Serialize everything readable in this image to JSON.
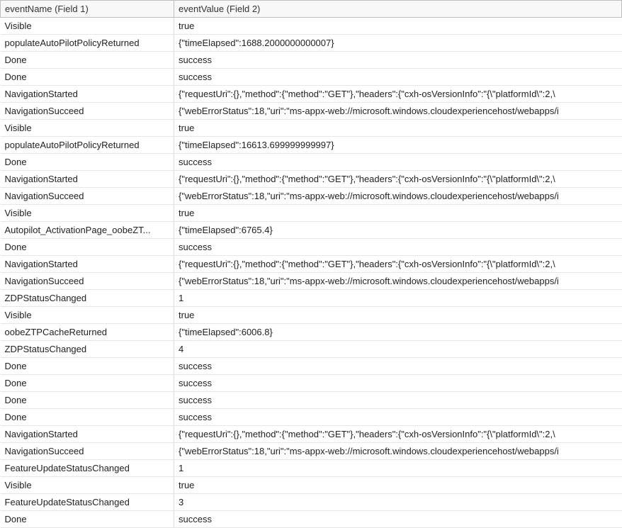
{
  "columns": {
    "col1": "eventName (Field 1)",
    "col2": "eventValue (Field 2)"
  },
  "rows": [
    {
      "name": "Visible",
      "value": "true"
    },
    {
      "name": "populateAutoPilotPolicyReturned",
      "value": "{\"timeElapsed\":1688.2000000000007}"
    },
    {
      "name": "Done",
      "value": "success"
    },
    {
      "name": "Done",
      "value": "success"
    },
    {
      "name": "NavigationStarted",
      "value": "{\"requestUri\":{},\"method\":{\"method\":\"GET\"},\"headers\":{\"cxh-osVersionInfo\":\"{\\\"platformId\\\":2,\\"
    },
    {
      "name": "NavigationSucceed",
      "value": "{\"webErrorStatus\":18,\"uri\":\"ms-appx-web://microsoft.windows.cloudexperiencehost/webapps/i"
    },
    {
      "name": "Visible",
      "value": "true"
    },
    {
      "name": "populateAutoPilotPolicyReturned",
      "value": "{\"timeElapsed\":16613.699999999997}"
    },
    {
      "name": "Done",
      "value": "success"
    },
    {
      "name": "NavigationStarted",
      "value": "{\"requestUri\":{},\"method\":{\"method\":\"GET\"},\"headers\":{\"cxh-osVersionInfo\":\"{\\\"platformId\\\":2,\\"
    },
    {
      "name": "NavigationSucceed",
      "value": "{\"webErrorStatus\":18,\"uri\":\"ms-appx-web://microsoft.windows.cloudexperiencehost/webapps/i"
    },
    {
      "name": "Visible",
      "value": "true"
    },
    {
      "name": "Autopilot_ActivationPage_oobeZT...",
      "value": "{\"timeElapsed\":6765.4}"
    },
    {
      "name": "Done",
      "value": "success"
    },
    {
      "name": "NavigationStarted",
      "value": "{\"requestUri\":{},\"method\":{\"method\":\"GET\"},\"headers\":{\"cxh-osVersionInfo\":\"{\\\"platformId\\\":2,\\"
    },
    {
      "name": "NavigationSucceed",
      "value": "{\"webErrorStatus\":18,\"uri\":\"ms-appx-web://microsoft.windows.cloudexperiencehost/webapps/i"
    },
    {
      "name": "ZDPStatusChanged",
      "value": "1"
    },
    {
      "name": "Visible",
      "value": "true"
    },
    {
      "name": "oobeZTPCacheReturned",
      "value": "{\"timeElapsed\":6006.8}"
    },
    {
      "name": "ZDPStatusChanged",
      "value": "4"
    },
    {
      "name": "Done",
      "value": "success"
    },
    {
      "name": "Done",
      "value": "success"
    },
    {
      "name": "Done",
      "value": "success"
    },
    {
      "name": "Done",
      "value": "success"
    },
    {
      "name": "NavigationStarted",
      "value": "{\"requestUri\":{},\"method\":{\"method\":\"GET\"},\"headers\":{\"cxh-osVersionInfo\":\"{\\\"platformId\\\":2,\\"
    },
    {
      "name": "NavigationSucceed",
      "value": "{\"webErrorStatus\":18,\"uri\":\"ms-appx-web://microsoft.windows.cloudexperiencehost/webapps/i"
    },
    {
      "name": "FeatureUpdateStatusChanged",
      "value": "1"
    },
    {
      "name": "Visible",
      "value": "true"
    },
    {
      "name": "FeatureUpdateStatusChanged",
      "value": "3"
    },
    {
      "name": "Done",
      "value": "success"
    }
  ]
}
